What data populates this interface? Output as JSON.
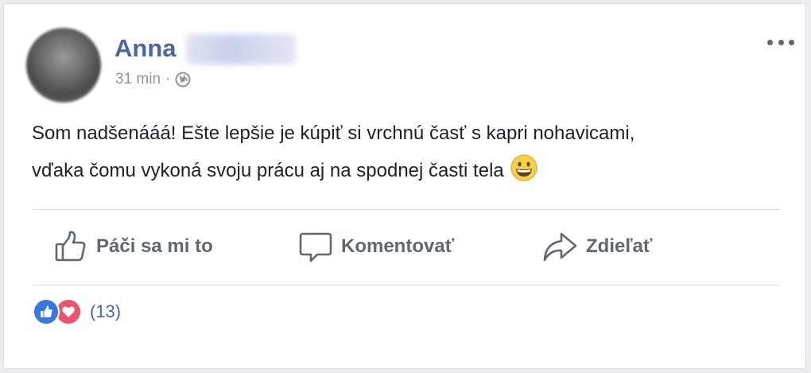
{
  "post": {
    "author": "Anna",
    "time": "31 min",
    "separator": "·",
    "text_line1": "Som nadšenááá! Ešte lepšie je kúpiť si vrchnú časť s kapri nohavicami,",
    "text_line2": "vďaka čomu vykoná svoju prácu aj na spodnej časti tela"
  },
  "actions": {
    "like_label": "Páči sa mi to",
    "comment_label": "Komentovať",
    "share_label": "Zdieľať"
  },
  "reactions": {
    "count": "(13)"
  },
  "icons": {
    "privacy": "globe-icon",
    "menu": "more-options-icon",
    "like": "thumbs-up-icon",
    "comment": "speech-bubble-icon",
    "share": "share-arrow-icon",
    "emoji": "grinning-face-icon"
  },
  "colors": {
    "author": "#4b67a1",
    "secondary_text": "#90949c",
    "action_text": "#606770",
    "like_reaction": "#3578e5",
    "love_reaction": "#f0536f"
  }
}
